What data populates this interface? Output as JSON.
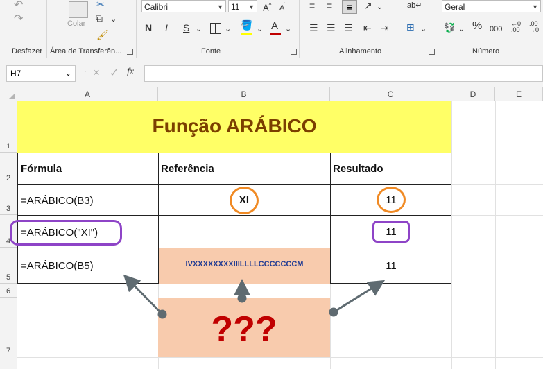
{
  "ribbon": {
    "groups": {
      "undo": "Desfazer",
      "clipboard": "Área de Transferên...",
      "font": "Fonte",
      "alignment": "Alinhamento",
      "number": "Número"
    },
    "paste_label": "Colar",
    "font_name": "Calibri",
    "font_size": "11",
    "bold": "N",
    "italic": "I",
    "underline": "S",
    "number_format": "Geral",
    "percent": "%",
    "thousands": "000",
    "font_color": "#c00000",
    "fill_color": "#ffff00"
  },
  "formula_bar": {
    "name_box": "H7",
    "fx": "fx",
    "cancel": "×",
    "confirm": "✓",
    "value": ""
  },
  "columns": [
    "A",
    "B",
    "C",
    "D",
    "E"
  ],
  "rows": [
    "1",
    "2",
    "3",
    "4",
    "5",
    "6",
    "7"
  ],
  "sheet": {
    "title": "Função ARÁBICO",
    "headers": {
      "a": "Fórmula",
      "b": "Referência",
      "c": "Resultado"
    },
    "row3": {
      "a": "=ARÁBICO(B3)",
      "b": "XI",
      "c": "11"
    },
    "row4": {
      "a": "=ARÁBICO(\"XI\")",
      "b": "",
      "c": "11"
    },
    "row5": {
      "a": "=ARÁBICO(B5)",
      "b": "IVXXXXXXXXIIILLLLCCCCCCCM",
      "c": "11"
    },
    "question": "???"
  },
  "colors": {
    "title_fill": "#ffff66",
    "title_text": "#7b3f00",
    "peach_fill": "#f8cbad",
    "ref_text": "#1f3a93",
    "question_text": "#c00000",
    "orange_circle": "#f08a24",
    "purple_box": "#8e44c7",
    "arrow": "#5f6b71"
  }
}
